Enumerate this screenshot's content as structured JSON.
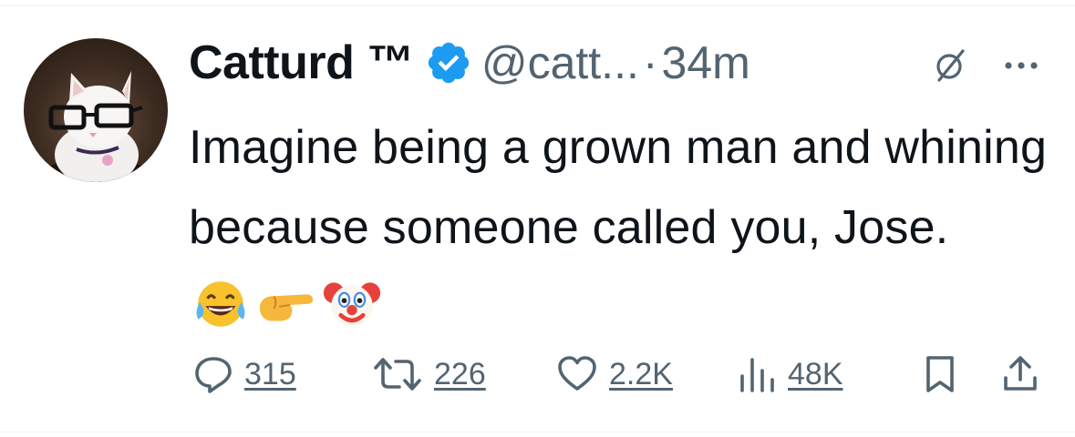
{
  "tweet": {
    "author_name": "Catturd ™",
    "handle": "@catt...",
    "separator": "·",
    "time": "34m",
    "text": "Imagine being a grown man and whining because someone called you, Jose.",
    "emojis": [
      "face-with-tears-of-joy",
      "backhand-index-pointing-right",
      "clown-face"
    ]
  },
  "actions": {
    "replies": "315",
    "retweets": "226",
    "likes": "2.2K",
    "views": "48K"
  },
  "colors": {
    "text": "#0f1419",
    "secondary": "#536471",
    "verified": "#1d9bf0"
  },
  "icons": {
    "verified": "verified-badge-icon",
    "grok": "grok-icon",
    "more": "more-icon",
    "reply": "reply-icon",
    "retweet": "retweet-icon",
    "like": "heart-icon",
    "views": "views-icon",
    "bookmark": "bookmark-icon",
    "share": "share-icon"
  }
}
